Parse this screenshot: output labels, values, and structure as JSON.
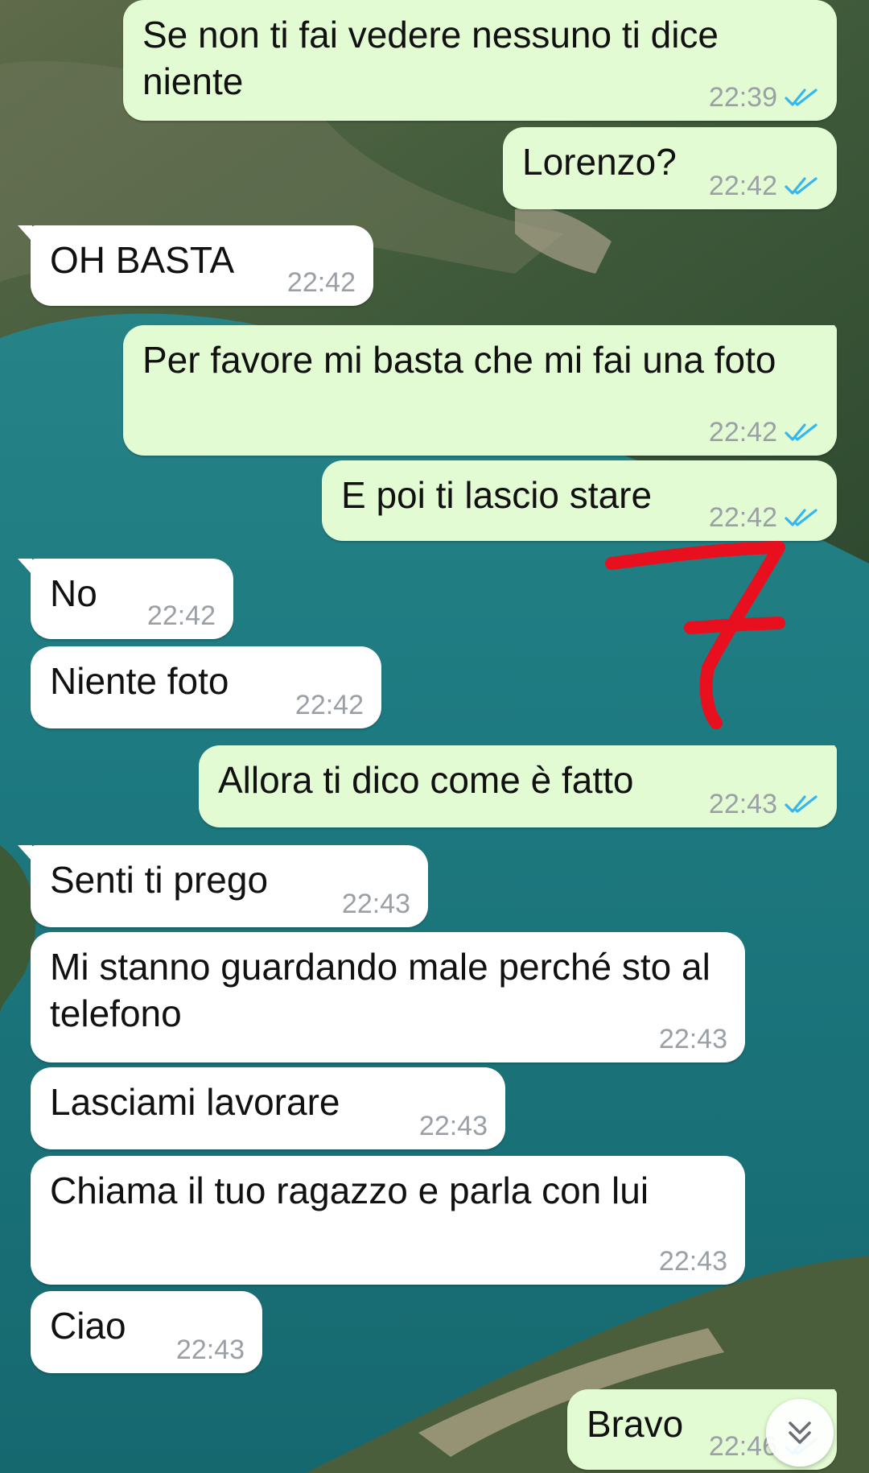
{
  "messages": [
    {
      "dir": "out",
      "text": "Se non ti fai vedere nessuno ti dice niente",
      "time": "22:39",
      "read": true
    },
    {
      "dir": "out",
      "text": "Lorenzo?",
      "time": "22:42",
      "read": true
    },
    {
      "dir": "in",
      "text": "OH BASTA",
      "time": "22:42"
    },
    {
      "dir": "out",
      "text": "Per favore mi basta che mi fai una foto",
      "time": "22:42",
      "read": true
    },
    {
      "dir": "out",
      "text": "E poi ti lascio stare",
      "time": "22:42",
      "read": true
    },
    {
      "dir": "in",
      "text": "No",
      "time": "22:42"
    },
    {
      "dir": "in",
      "text": "Niente foto",
      "time": "22:42"
    },
    {
      "dir": "out",
      "text": "Allora ti dico come è fatto",
      "time": "22:43",
      "read": true
    },
    {
      "dir": "in",
      "text": "Senti ti prego",
      "time": "22:43"
    },
    {
      "dir": "in",
      "text": "Mi stanno guardando male perché sto al telefono",
      "time": "22:43"
    },
    {
      "dir": "in",
      "text": "Lasciami lavorare",
      "time": "22:43"
    },
    {
      "dir": "in",
      "text": "Chiama il tuo ragazzo e parla con lui",
      "time": "22:43"
    },
    {
      "dir": "in",
      "text": "Ciao",
      "time": "22:43"
    },
    {
      "dir": "out",
      "text": "Bravo",
      "time": "22:46",
      "read": true
    }
  ],
  "annotation": {
    "text": "7",
    "color": "#e8101e"
  },
  "colors": {
    "outgoing_bubble": "#e2fbd3",
    "incoming_bubble": "#ffffff",
    "read_ticks": "#34b7f1",
    "timestamp": "#9aa0a6"
  },
  "icons": {
    "read_receipt": "double-check-icon",
    "scroll_down": "chevron-double-down-icon"
  }
}
